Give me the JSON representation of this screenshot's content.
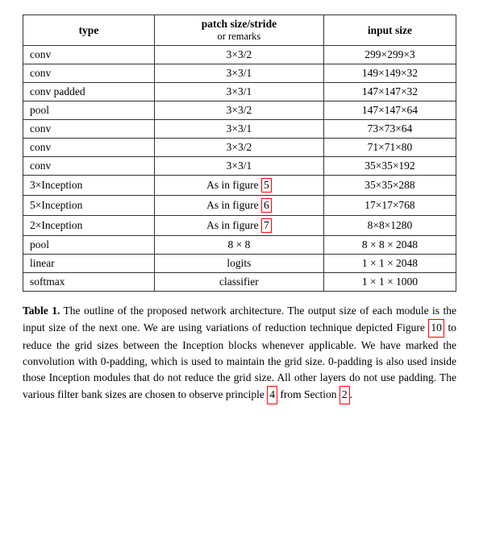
{
  "table": {
    "headers": {
      "col1": "type",
      "col2_main": "patch size/stride",
      "col2_sub": "or remarks",
      "col3": "input size"
    },
    "rows": [
      {
        "type": "conv",
        "patch": "3×3/2",
        "input": "299×299×3"
      },
      {
        "type": "conv",
        "patch": "3×3/1",
        "input": "149×149×32"
      },
      {
        "type": "conv padded",
        "patch": "3×3/1",
        "input": "147×147×32"
      },
      {
        "type": "pool",
        "patch": "3×3/2",
        "input": "147×147×64"
      },
      {
        "type": "conv",
        "patch": "3×3/1",
        "input": "73×73×64"
      },
      {
        "type": "conv",
        "patch": "3×3/2",
        "input": "71×71×80"
      },
      {
        "type": "conv",
        "patch": "3×3/1",
        "input": "35×35×192"
      },
      {
        "type": "3×Inception",
        "patch": "As in figure 5",
        "input": "35×35×288",
        "highlight_patch": true
      },
      {
        "type": "5×Inception",
        "patch": "As in figure 6",
        "input": "17×17×768",
        "highlight_patch": true
      },
      {
        "type": "2×Inception",
        "patch": "As in figure 7",
        "input": "8×8×1280",
        "highlight_patch": true
      },
      {
        "type": "pool",
        "patch": "8 × 8",
        "input": "8 × 8 × 2048"
      },
      {
        "type": "linear",
        "patch": "logits",
        "input": "1 × 1 × 2048"
      },
      {
        "type": "softmax",
        "patch": "classifier",
        "input": "1 × 1 × 1000"
      }
    ]
  },
  "caption": {
    "label": "Table 1.",
    "text": " The outline of the proposed network architecture.  The output size of each module is the input size of the next one.  We are using variations of reduction technique depicted Figure ",
    "link1": "10",
    "text2": " to reduce the grid sizes between the Inception blocks whenever applicable.  We have marked the convolution with 0-padding, which is used to maintain the grid size.  0-padding is also used inside those Inception modules that do not reduce the grid size.  All other layers do not use padding.  The various filter bank sizes are chosen to observe principle ",
    "link2": "4",
    "text3": " from Section ",
    "link3": "2",
    "text4": "."
  }
}
